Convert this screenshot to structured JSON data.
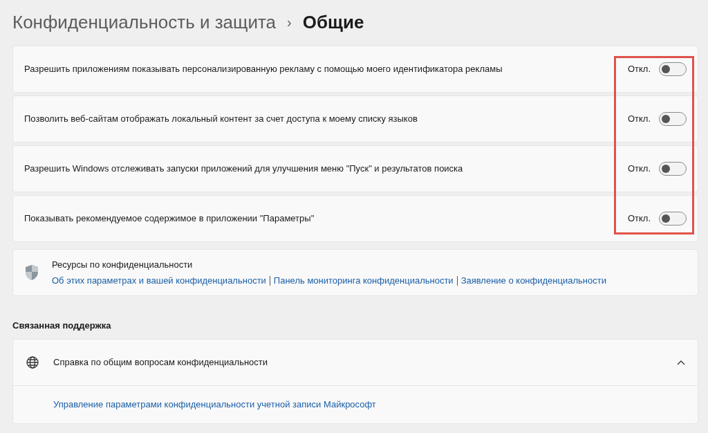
{
  "breadcrumb": {
    "parent": "Конфиденциальность и защита",
    "separator": "›",
    "current": "Общие"
  },
  "settings": [
    {
      "label": "Разрешить приложениям показывать персонализированную рекламу с помощью моего идентификатора рекламы",
      "state": "Откл.",
      "on": false
    },
    {
      "label": "Позволить веб-сайтам отображать локальный контент за счет доступа к моему списку языков",
      "state": "Откл.",
      "on": false
    },
    {
      "label": "Разрешить Windows отслеживать запуски приложений для улучшения меню \"Пуск\" и результатов поиска",
      "state": "Откл.",
      "on": false
    },
    {
      "label": "Показывать рекомендуемое содержимое в приложении \"Параметры\"",
      "state": "Откл.",
      "on": false
    }
  ],
  "resources": {
    "title": "Ресурсы по конфиденциальности",
    "links": [
      "Об этих параметрах и вашей конфиденциальности",
      "Панель мониторинга конфиденциальности",
      "Заявление о конфиденциальности"
    ]
  },
  "related_support": {
    "heading": "Связанная поддержка",
    "item": {
      "title": "Справка по общим вопросам конфиденциальности",
      "expanded": true,
      "links": [
        "Управление параметрами конфиденциальности учетной записи Майкрософт"
      ]
    }
  }
}
